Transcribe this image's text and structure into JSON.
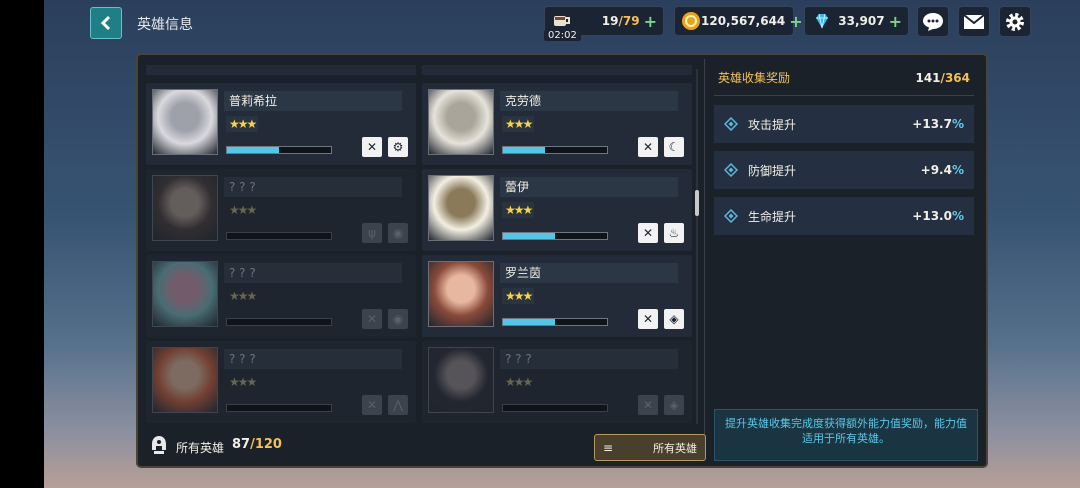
{
  "header": {
    "title": "英雄信息",
    "stamina": {
      "current": "19",
      "max": "79",
      "timer": "02:02"
    },
    "gold": "120,567,644",
    "gems": "33,907"
  },
  "heroes": [
    {
      "name": "普莉希拉",
      "stars": "★★★",
      "progress": 0.5,
      "locked": false,
      "colors": [
        "#d9d9de",
        "#9ea0aa"
      ]
    },
    {
      "name": "克劳德",
      "stars": "★★★",
      "progress": 0.4,
      "locked": false,
      "colors": [
        "#e6e3da",
        "#a9a59a"
      ]
    },
    {
      "name": "? ? ?",
      "stars": "★★★",
      "progress": 0,
      "locked": true,
      "colors": [
        "#4a3a36",
        "#b8a294"
      ]
    },
    {
      "name": "蕾伊",
      "stars": "★★★",
      "progress": 0.5,
      "locked": false,
      "colors": [
        "#f3efe2",
        "#8a7a5a"
      ]
    },
    {
      "name": "? ? ?",
      "stars": "★★★",
      "progress": 0,
      "locked": true,
      "colors": [
        "#7fc4c8",
        "#d9a0b8"
      ]
    },
    {
      "name": "罗兰茵",
      "stars": "★★★",
      "progress": 0.5,
      "locked": false,
      "colors": [
        "#8a4a3a",
        "#e7b7a0"
      ]
    },
    {
      "name": "? ? ?",
      "stars": "★★★",
      "progress": 0,
      "locked": true,
      "colors": [
        "#d9623a",
        "#f1c0a0"
      ]
    },
    {
      "name": "? ? ?",
      "stars": "★★★",
      "progress": 0,
      "locked": true,
      "colors": [
        "#2a2a34",
        "#9a8e8e"
      ]
    }
  ],
  "bonus": {
    "title": "英雄收集奖励",
    "collected": "141",
    "total": "364",
    "stats": [
      {
        "label": "攻击提升",
        "value": "+13.7",
        "unit": "%"
      },
      {
        "label": "防御提升",
        "value": "+9.4",
        "unit": "%"
      },
      {
        "label": "生命提升",
        "value": "+13.0",
        "unit": "%"
      }
    ],
    "info": "提升英雄收集完成度获得额外能力值奖励，能力值适用于所有英雄。"
  },
  "footer": {
    "label": "所有英雄",
    "owned": "87",
    "total": "120",
    "filter_label": "所有英雄"
  },
  "colors": {
    "accent": "#f2c15a",
    "cyan": "#55c6e6",
    "teal": "#1f7f86"
  }
}
